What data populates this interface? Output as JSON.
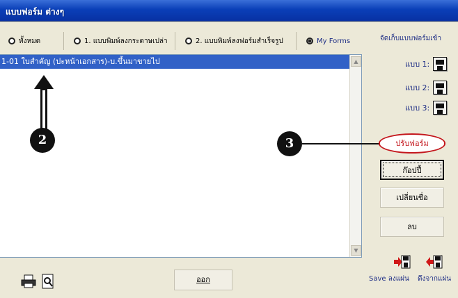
{
  "window": {
    "title": "แบบฟอร์ม ต่างๆ"
  },
  "radio_tabs": [
    {
      "label": "ทั้งหมด",
      "selected": false
    },
    {
      "label": "1. แบบพิมพ์ลงกระดาษเปล่า",
      "selected": false
    },
    {
      "label": "2. แบบพิมพ์ลงฟอร์มสำเร็จรูป",
      "selected": false
    },
    {
      "label": "My Forms",
      "selected": true
    }
  ],
  "list": {
    "items": [
      "1-01 ใบสำคัญ (ปะหน้าเอกสาร)-บ.ขึ้นมาขายไป"
    ]
  },
  "annotations": {
    "badge_2": "2",
    "badge_3": "3"
  },
  "right_panel": {
    "title": "จัดเก็บแบบฟอร์มเข้า",
    "slots": [
      {
        "label": "แบบ 1:",
        "icon": "floppy-disk-icon"
      },
      {
        "label": "แบบ 2:",
        "icon": "floppy-disk-icon"
      },
      {
        "label": "แบบ 3:",
        "icon": "floppy-disk-icon"
      }
    ],
    "buttons": {
      "adjust": "ปรับฟอร์ม",
      "copy": "ก๊อปปี้",
      "rename": "เปลี่ยนชื่อ",
      "delete": "ลบ"
    },
    "disk_actions": {
      "save": "Save ลงแผ่น",
      "load": "ดึงจากแผ่น"
    }
  },
  "bottom": {
    "exit": "ออก"
  },
  "colors": {
    "title_bar": "#0a3fb8",
    "selection": "#3161c7",
    "highlight": "#c4171d",
    "panel_text": "#1f2f86"
  }
}
